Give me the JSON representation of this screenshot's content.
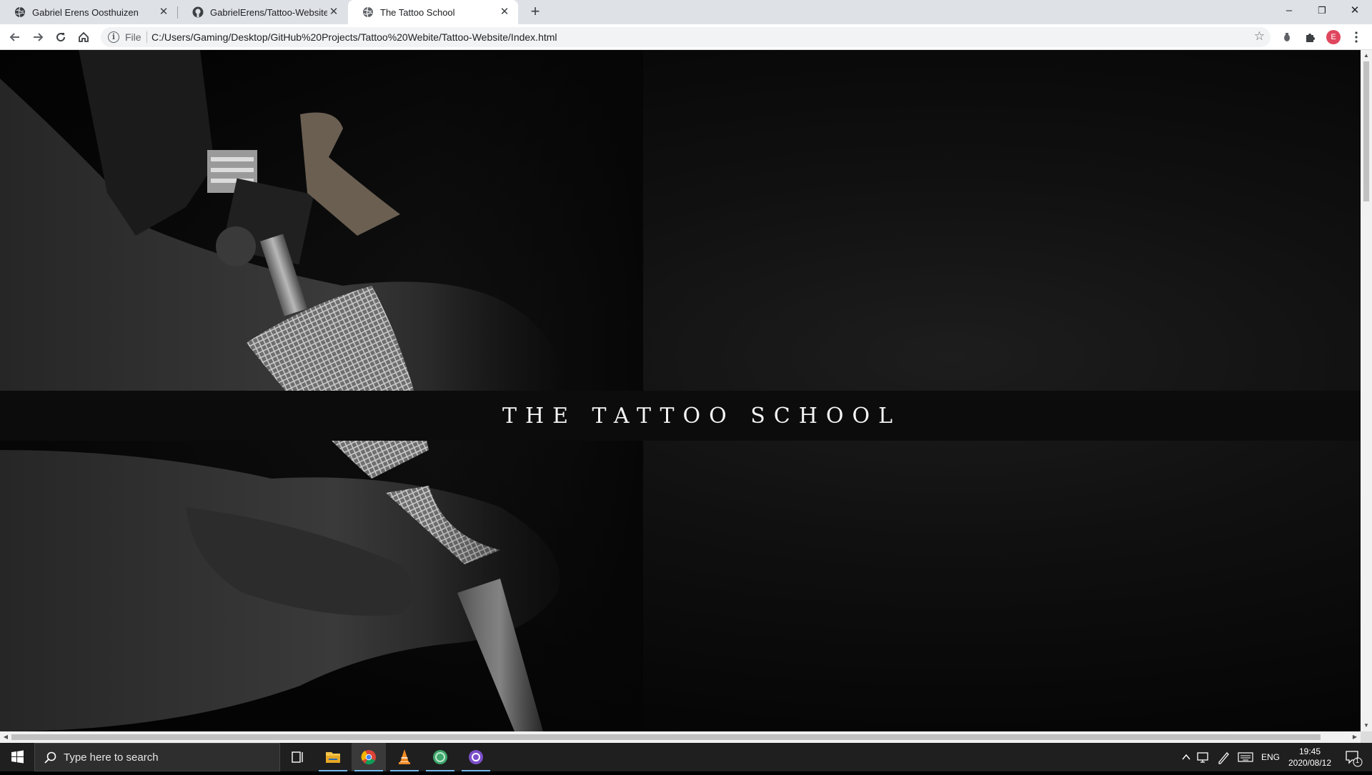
{
  "browser": {
    "tabs": [
      {
        "title": "Gabriel Erens Oosthuizen",
        "active": false
      },
      {
        "title": "GabrielErens/Tattoo-Website: Mo",
        "active": false
      },
      {
        "title": "The Tattoo School",
        "active": true
      }
    ],
    "new_tab_label": "+",
    "window_controls": {
      "minimize": "–",
      "restore": "❐",
      "close": "✕"
    },
    "address": {
      "scheme_label": "File",
      "url": "C:/Users/Gaming/Desktop/GitHub%20Projects/Tattoo%20Webite/Tattoo-Website/Index.html"
    },
    "profile_initial": "E"
  },
  "page": {
    "banner_title": "THE TATTOO SCHOOL",
    "colors": {
      "background": "#050505",
      "banner": "#0c0c0c",
      "title": "#f4f4f4"
    }
  },
  "taskbar": {
    "search_placeholder": "Type here to search",
    "apps": [
      "task-view",
      "file-explorer",
      "chrome",
      "vlc",
      "app-green",
      "app-purple"
    ],
    "language": "ENG",
    "time": "19:45",
    "date": "2020/08/12",
    "notification_count": "1"
  }
}
